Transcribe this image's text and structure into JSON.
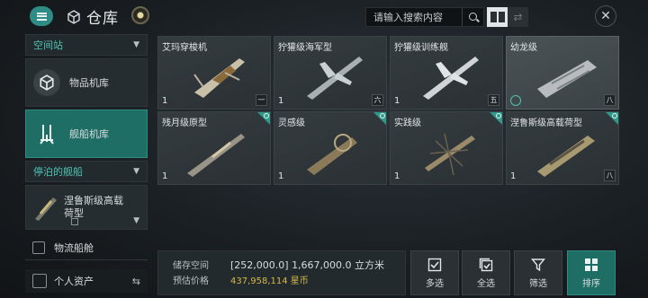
{
  "header": {
    "title": "仓库",
    "search_placeholder": "请输入搜索内容"
  },
  "sidebar": {
    "station_section": "空间站",
    "items": [
      {
        "label": "物品机库",
        "icon": "item-hangar-icon",
        "active": false
      },
      {
        "label": "舰船机库",
        "icon": "ship-hangar-icon",
        "active": true
      }
    ],
    "docked_section": "停泊的舰船",
    "docked_ship": "涅鲁斯级高载荷型",
    "cargo_label": "物流船舱",
    "assets_label": "个人资产"
  },
  "ships": [
    {
      "name": "艾玛穿梭机",
      "qty": "1",
      "tier": "一",
      "corner": false,
      "selected": false,
      "badge": false
    },
    {
      "name": "狞獾级海军型",
      "qty": "1",
      "tier": "六",
      "corner": false,
      "selected": false,
      "badge": false
    },
    {
      "name": "狞獾级训练舰",
      "qty": "1",
      "tier": "五",
      "corner": false,
      "selected": false,
      "badge": false
    },
    {
      "name": "幼龙级",
      "qty": "",
      "tier": "八",
      "corner": false,
      "selected": true,
      "badge": true
    },
    {
      "name": "残月级原型",
      "qty": "1",
      "tier": "",
      "corner": true,
      "selected": false,
      "badge": false
    },
    {
      "name": "灵感级",
      "qty": "1",
      "tier": "",
      "corner": true,
      "selected": false,
      "badge": false
    },
    {
      "name": "实践级",
      "qty": "1",
      "tier": "",
      "corner": true,
      "selected": false,
      "badge": false
    },
    {
      "name": "涅鲁斯级高载荷型",
      "qty": "1",
      "tier": "八",
      "corner": true,
      "selected": false,
      "badge": false
    }
  ],
  "storage": {
    "space_label": "储存空间",
    "space_value": "[252,000.0] 1,667,000.0 立方米",
    "price_label": "预估价格",
    "price_value": "437,958,114 星币"
  },
  "actions": [
    {
      "label": "多选",
      "icon": "multi-select-icon"
    },
    {
      "label": "全选",
      "icon": "select-all-icon"
    },
    {
      "label": "筛选",
      "icon": "filter-icon"
    },
    {
      "label": "排序",
      "icon": "sort-icon"
    }
  ],
  "colors": {
    "accent": "#2e8c84",
    "accent_text": "#4ec4b4",
    "price": "#d4b84a"
  }
}
